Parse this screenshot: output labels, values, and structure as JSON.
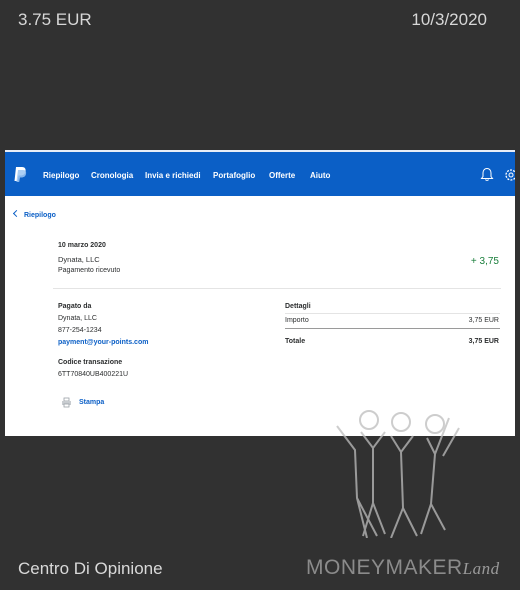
{
  "header": {
    "amount": "3.75 EUR",
    "date": "10/3/2020"
  },
  "footer": {
    "source": "Centro Di Opinione",
    "brand": "MONEYMAKER",
    "brand_suffix": "Land"
  },
  "nav": {
    "items": [
      "Riepilogo",
      "Cronologia",
      "Invia e richiedi",
      "Portafoglio",
      "Offerte",
      "Aiuto"
    ]
  },
  "back_link": "Riepilogo",
  "transaction": {
    "date": "10 marzo 2020",
    "name": "Dynata, LLC",
    "status": "Pagamento ricevuto",
    "amount": "+ 3,75"
  },
  "paid_by": {
    "title": "Pagato da",
    "name": "Dynata, LLC",
    "phone": "877-254-1234",
    "email": "payment@your-points.com"
  },
  "details": {
    "title": "Dettagli",
    "amount_label": "Importo",
    "amount_value": "3,75 EUR",
    "total_label": "Totale",
    "total_value": "3,75 EUR"
  },
  "transaction_code": {
    "title": "Codice transazione",
    "value": "6TT70840UB400221U"
  },
  "print_label": "Stampa",
  "colors": {
    "nav_blue": "#0b5fc6",
    "positive_green": "#1a7f3c",
    "background": "#313131"
  }
}
